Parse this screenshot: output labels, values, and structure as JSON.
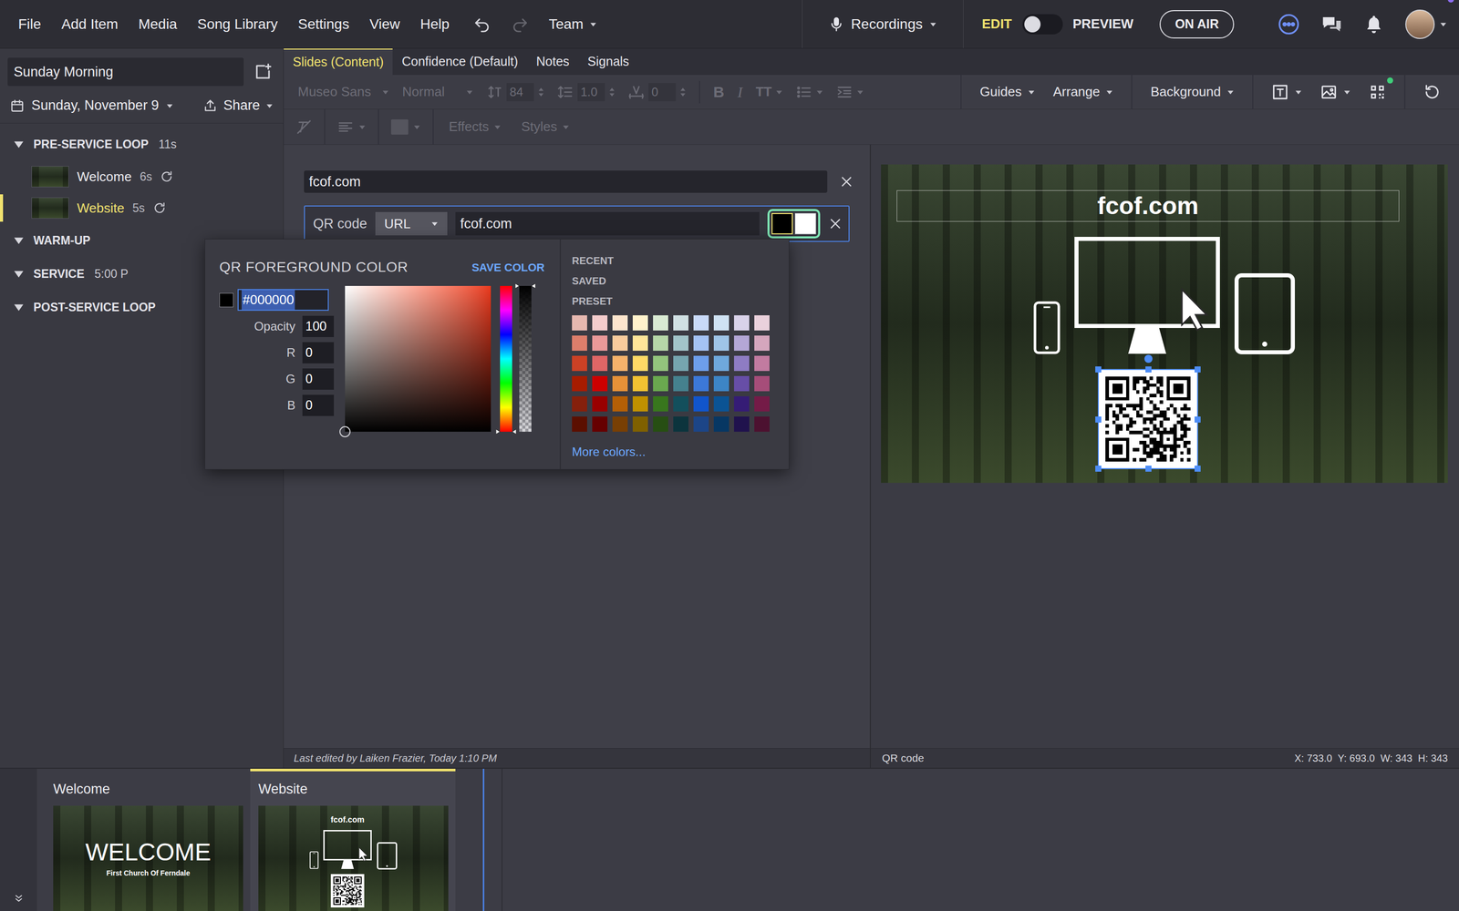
{
  "menu_bar": {
    "items": [
      "File",
      "Add Item",
      "Media",
      "Song Library",
      "Settings",
      "View",
      "Help"
    ],
    "team": "Team"
  },
  "header_right": {
    "recordings": "Recordings",
    "modes": [
      {
        "label": "EDIT",
        "selected": true
      },
      {
        "label": "PREVIEW",
        "selected": false
      }
    ],
    "on_air": "ON AIR",
    "account_alert": true
  },
  "sidebar": {
    "plan_title": "Sunday Morning",
    "date": "Sunday, November 9",
    "share": "Share",
    "sections": [
      {
        "name": "PRE-SERVICE LOOP",
        "meta": "11s",
        "expanded": true,
        "items": [
          {
            "name": "Welcome",
            "duration": "6s",
            "looping": true,
            "selected": false
          },
          {
            "name": "Website",
            "duration": "5s",
            "looping": true,
            "selected": true
          }
        ]
      },
      {
        "name": "WARM-UP",
        "meta": "",
        "expanded": true,
        "items": []
      },
      {
        "name": "SERVICE",
        "meta": "5:00 P",
        "expanded": true,
        "items": []
      },
      {
        "name": "POST-SERVICE LOOP",
        "meta": "",
        "expanded": true,
        "items": []
      }
    ]
  },
  "editor_tabs": [
    {
      "label": "Slides (Content)",
      "selected": true
    },
    {
      "label": "Confidence (Default)",
      "selected": false
    },
    {
      "label": "Notes",
      "selected": false
    },
    {
      "label": "Signals",
      "selected": false
    }
  ],
  "format_bar": {
    "disabled": true,
    "font": "Museo Sans",
    "weight": "Normal",
    "size": "84",
    "line_height": "1.0",
    "letter_spacing": "0",
    "style_buttons": [
      "B",
      "I",
      "TT"
    ],
    "menus": [
      "Guides",
      "Arrange",
      "Background"
    ],
    "qr_badge": true
  },
  "format_bar2": {
    "disabled": true,
    "menus": [
      "Effects",
      "Styles"
    ]
  },
  "fields": [
    {
      "kind": "text",
      "value": "fcof.com"
    },
    {
      "kind": "qr",
      "label": "QR code",
      "type": "URL",
      "value": "fcof.com",
      "foreground": "#000000",
      "background": "#ffffff",
      "selected": true
    }
  ],
  "color_picker": {
    "title": "QR FOREGROUND COLOR",
    "save": "SAVE COLOR",
    "hex": "#000000",
    "opacity_label": "Opacity",
    "opacity": "100",
    "channels": [
      {
        "label": "R",
        "value": "0"
      },
      {
        "label": "G",
        "value": "0"
      },
      {
        "label": "B",
        "value": "0"
      }
    ],
    "saturation_level": 0,
    "brightness_level": 0,
    "hue_level": 0,
    "alpha_level": 1,
    "groups": [
      "RECENT",
      "SAVED",
      "PRESET"
    ],
    "presets": [
      {
        "color": "#e6b8af"
      },
      {
        "color": "#f4cccc"
      },
      {
        "color": "#fce5cd"
      },
      {
        "color": "#fff2cc"
      },
      {
        "color": "#d9ead3"
      },
      {
        "color": "#d0e0e3"
      },
      {
        "color": "#c9daf8"
      },
      {
        "color": "#cfe2f3"
      },
      {
        "color": "#d9d2e9"
      },
      {
        "color": "#ead1dc"
      },
      {
        "color": "#dd7e6b"
      },
      {
        "color": "#ea9999"
      },
      {
        "color": "#f9cb9c"
      },
      {
        "color": "#ffe599"
      },
      {
        "color": "#b6d7a8"
      },
      {
        "color": "#a2c4c9"
      },
      {
        "color": "#a4c2f4"
      },
      {
        "color": "#9fc5e8"
      },
      {
        "color": "#b4a7d6"
      },
      {
        "color": "#d5a6bd"
      },
      {
        "color": "#cc4125"
      },
      {
        "color": "#e06666"
      },
      {
        "color": "#f6b26b"
      },
      {
        "color": "#ffd966"
      },
      {
        "color": "#93c47d"
      },
      {
        "color": "#76a5af"
      },
      {
        "color": "#6d9eeb"
      },
      {
        "color": "#6fa8dc"
      },
      {
        "color": "#8e7cc3"
      },
      {
        "color": "#c27ba0"
      },
      {
        "color": "#a61c00"
      },
      {
        "color": "#cc0000"
      },
      {
        "color": "#e69138"
      },
      {
        "color": "#f1c232"
      },
      {
        "color": "#6aa84f"
      },
      {
        "color": "#45818e"
      },
      {
        "color": "#3c78d8"
      },
      {
        "color": "#3d85c6"
      },
      {
        "color": "#674ea7"
      },
      {
        "color": "#a64d79"
      },
      {
        "color": "#85200c"
      },
      {
        "color": "#990000"
      },
      {
        "color": "#b45f06"
      },
      {
        "color": "#bf9000"
      },
      {
        "color": "#38761d"
      },
      {
        "color": "#134f5c"
      },
      {
        "color": "#1155cc"
      },
      {
        "color": "#0b5394"
      },
      {
        "color": "#351c75"
      },
      {
        "color": "#741b47"
      },
      {
        "color": "#5b0f00"
      },
      {
        "color": "#660000"
      },
      {
        "color": "#783f04"
      },
      {
        "color": "#7f6000"
      },
      {
        "color": "#274e13"
      },
      {
        "color": "#0c343d"
      },
      {
        "color": "#1c4587"
      },
      {
        "color": "#073763"
      },
      {
        "color": "#20124d"
      },
      {
        "color": "#4c1130"
      }
    ],
    "more": "More colors..."
  },
  "preview": {
    "slide_title": "fcof.com",
    "selected_element": "QR code",
    "geometry": "X: 733.0  Y: 693.0  W: 343  H: 343"
  },
  "status": {
    "last_edited": "Last edited by Laiken Frazier, Today 1:10 PM"
  },
  "filmstrip": [
    {
      "label": "Welcome",
      "selected": false,
      "kind": "welcome",
      "title": "WELCOME",
      "subtitle": "First Church Of Ferndale"
    },
    {
      "label": "Website",
      "selected": true,
      "kind": "website",
      "title": "fcof.com"
    }
  ]
}
